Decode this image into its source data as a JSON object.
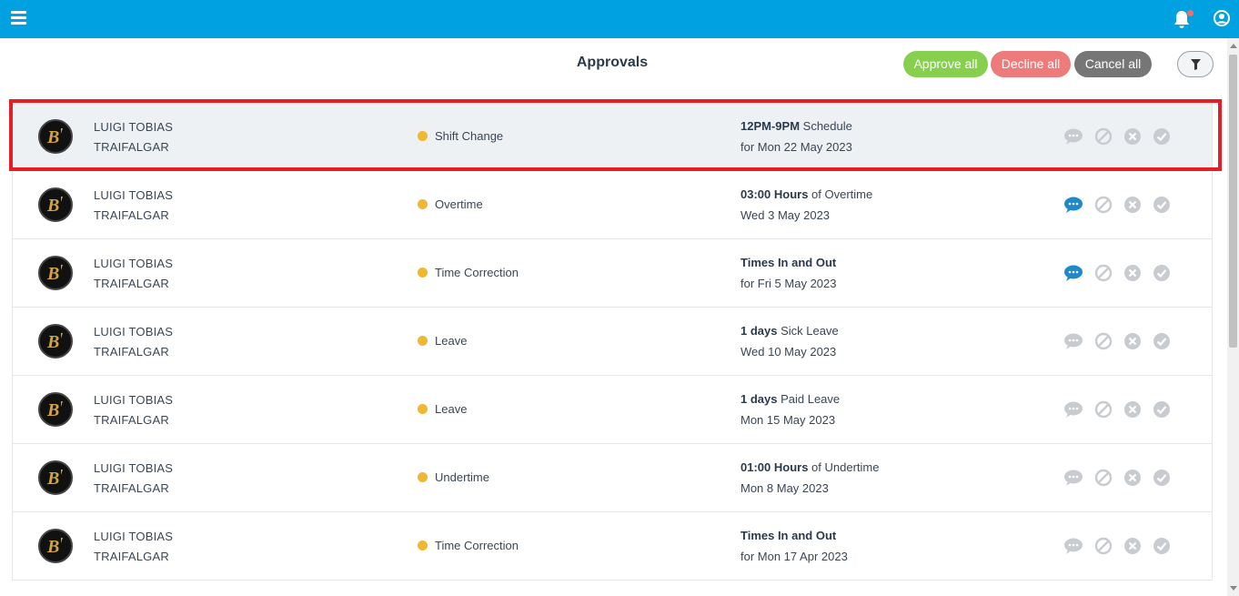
{
  "header": {
    "title": "Approvals"
  },
  "toolbar": {
    "approve_label": "Approve all",
    "decline_label": "Decline all",
    "cancel_label": "Cancel all"
  },
  "colors": {
    "topbar": "#00a1e0",
    "approve": "#86cf4f",
    "decline": "#ed7b7b",
    "cancel": "#767676",
    "status_pending": "#f0b731",
    "highlight": "#e31e24",
    "comment_active": "#1e88c9",
    "icon_inactive": "#c8ccd0"
  },
  "rows": [
    {
      "first_name": "LUIGI TOBIAS",
      "last_name": "TRAIFALGAR",
      "type": "Shift Change",
      "detail_bold": "12PM-9PM",
      "detail_rest": " Schedule",
      "date": "for Mon 22 May 2023",
      "comment_active": false
    },
    {
      "first_name": "LUIGI TOBIAS",
      "last_name": "TRAIFALGAR",
      "type": "Overtime",
      "detail_bold": "03:00 Hours",
      "detail_rest": " of Overtime",
      "date": "Wed 3 May 2023",
      "comment_active": true
    },
    {
      "first_name": "LUIGI TOBIAS",
      "last_name": "TRAIFALGAR",
      "type": "Time Correction",
      "detail_bold": "Times In and Out",
      "detail_rest": "",
      "date": "for Fri 5 May 2023",
      "comment_active": true
    },
    {
      "first_name": "LUIGI TOBIAS",
      "last_name": "TRAIFALGAR",
      "type": "Leave",
      "detail_bold": "1 days",
      "detail_rest": " Sick Leave",
      "date": "Wed 10 May 2023",
      "comment_active": false
    },
    {
      "first_name": "LUIGI TOBIAS",
      "last_name": "TRAIFALGAR",
      "type": "Leave",
      "detail_bold": "1 days",
      "detail_rest": " Paid Leave",
      "date": "Mon 15 May 2023",
      "comment_active": false
    },
    {
      "first_name": "LUIGI TOBIAS",
      "last_name": "TRAIFALGAR",
      "type": "Undertime",
      "detail_bold": "01:00 Hours",
      "detail_rest": " of Undertime",
      "date": "Mon 8 May 2023",
      "comment_active": false
    },
    {
      "first_name": "LUIGI TOBIAS",
      "last_name": "TRAIFALGAR",
      "type": "Time Correction",
      "detail_bold": "Times In and Out",
      "detail_rest": "",
      "date": "for Mon 17 Apr 2023",
      "comment_active": false
    }
  ]
}
